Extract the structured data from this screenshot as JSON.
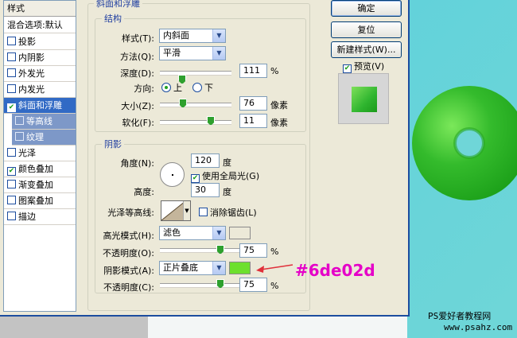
{
  "colors": {
    "highlight_swatch": "#ffffff",
    "shadow_swatch": "#6de02d",
    "annotation": "#e500c8",
    "donut": "#2fb52f"
  },
  "styles_list": {
    "header": "样式",
    "blend_options": "混合选项:默认",
    "items": [
      {
        "label": "投影",
        "checked": false
      },
      {
        "label": "内阴影",
        "checked": false
      },
      {
        "label": "外发光",
        "checked": false
      },
      {
        "label": "内发光",
        "checked": false
      },
      {
        "label": "斜面和浮雕",
        "checked": true,
        "selected": true
      },
      {
        "label": "等高线",
        "checked": false,
        "sub": true
      },
      {
        "label": "纹理",
        "checked": false,
        "sub": true
      },
      {
        "label": "光泽",
        "checked": false
      },
      {
        "label": "颜色叠加",
        "checked": true
      },
      {
        "label": "渐变叠加",
        "checked": false
      },
      {
        "label": "图案叠加",
        "checked": false
      },
      {
        "label": "描边",
        "checked": false
      }
    ]
  },
  "bevel": {
    "title": "斜面和浮雕",
    "structure_title": "结构",
    "style_label": "样式(T):",
    "style_value": "内斜面",
    "method_label": "方法(Q):",
    "method_value": "平滑",
    "depth_label": "深度(D):",
    "depth_value": "111",
    "depth_unit": "%",
    "depth_slider": 0.3,
    "direction_label": "方向:",
    "direction_up": "上",
    "direction_down": "下",
    "size_label": "大小(Z):",
    "size_value": "76",
    "size_unit": "像素",
    "size_slider": 0.31,
    "soften_label": "软化(F):",
    "soften_value": "11",
    "soften_unit": "像素",
    "soften_slider": 0.7
  },
  "shading": {
    "title": "阴影",
    "angle_label": "角度(N):",
    "angle_value": "120",
    "angle_unit": "度",
    "global_light_label": "使用全局光(G)",
    "altitude_label": "高度:",
    "altitude_value": "30",
    "altitude_unit": "度",
    "gloss_contour_label": "光泽等高线:",
    "anti_alias_label": "消除锯齿(L)",
    "highlight_mode_label": "高光模式(H):",
    "highlight_mode_value": "滤色",
    "highlight_opacity_label": "不透明度(O):",
    "highlight_opacity_value": "75",
    "highlight_opacity_unit": "%",
    "highlight_opacity_slider": 0.75,
    "shadow_mode_label": "阴影模式(A):",
    "shadow_mode_value": "正片叠底",
    "shadow_opacity_label": "不透明度(C):",
    "shadow_opacity_value": "75",
    "shadow_opacity_unit": "%",
    "shadow_opacity_slider": 0.75
  },
  "buttons": {
    "ok": "确定",
    "reset": "复位",
    "new_style": "新建样式(W)...",
    "preview": "预览(V)"
  },
  "annotation": "#6de02d",
  "watermark": {
    "line1": "PS爱好者教程网",
    "line2": "www.psahz.com"
  }
}
